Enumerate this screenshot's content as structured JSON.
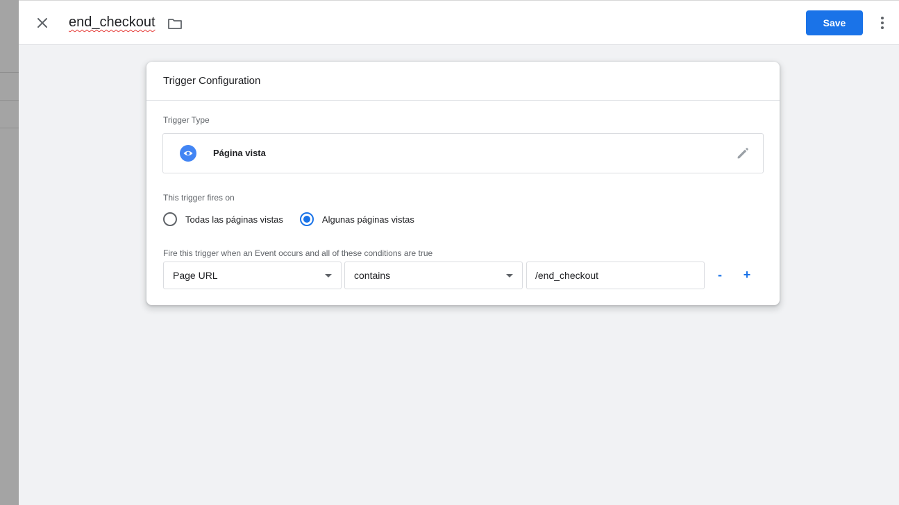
{
  "header": {
    "title": "end_checkout",
    "save_label": "Save"
  },
  "card": {
    "title": "Trigger Configuration",
    "trigger_type_label": "Trigger Type",
    "trigger_type_name": "Página vista",
    "fires_on_label": "This trigger fires on",
    "radio_options": [
      {
        "label": "Todas las páginas vistas",
        "checked": false
      },
      {
        "label": "Algunas páginas vistas",
        "checked": true
      }
    ],
    "condition_label": "Fire this trigger when an Event occurs and all of these conditions are true",
    "condition": {
      "variable": "Page URL",
      "operator": "contains",
      "value": "/end_checkout"
    },
    "remove_label": "-",
    "add_label": "+"
  },
  "colors": {
    "accent": "#1a73e8",
    "trigger_icon": "#4285f4"
  },
  "icons": [
    "close-icon",
    "folder-icon",
    "more-vert-icon",
    "eye-icon",
    "pencil-icon"
  ]
}
